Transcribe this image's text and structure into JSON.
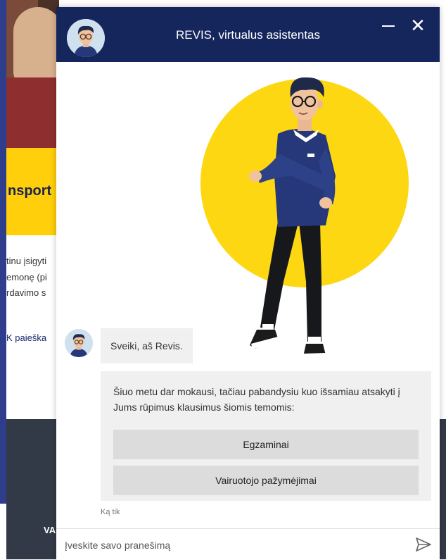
{
  "background": {
    "banner_text": "nsport",
    "lines": [
      "tinu įsigyti",
      "emonę (pi",
      "rdavimo s"
    ],
    "search_link": "K paieška",
    "footer_text": "VA"
  },
  "chat": {
    "header": {
      "title": "REVIS, virtualus asistentas"
    },
    "messages": {
      "greeting": "Sveiki, aš Revis.",
      "intro": "Šiuo metu dar mokausi, tačiau pabandysiu kuo išsamiau atsakyti į Jums rūpimus klausimus šiomis temomis:",
      "options": [
        "Egzaminai",
        "Vairuotojo pažymėjimai"
      ],
      "timestamp": "Ką tik"
    },
    "input": {
      "placeholder": "Įveskite savo pranešimą"
    },
    "colors": {
      "header_bg": "#15265c",
      "accent_yellow": "#fdd711",
      "bubble_bg": "#f0f0f0",
      "option_bg": "#dcdcdc"
    },
    "icons": {
      "minimize": "minimize-icon",
      "close": "close-icon",
      "send": "send-icon"
    }
  }
}
